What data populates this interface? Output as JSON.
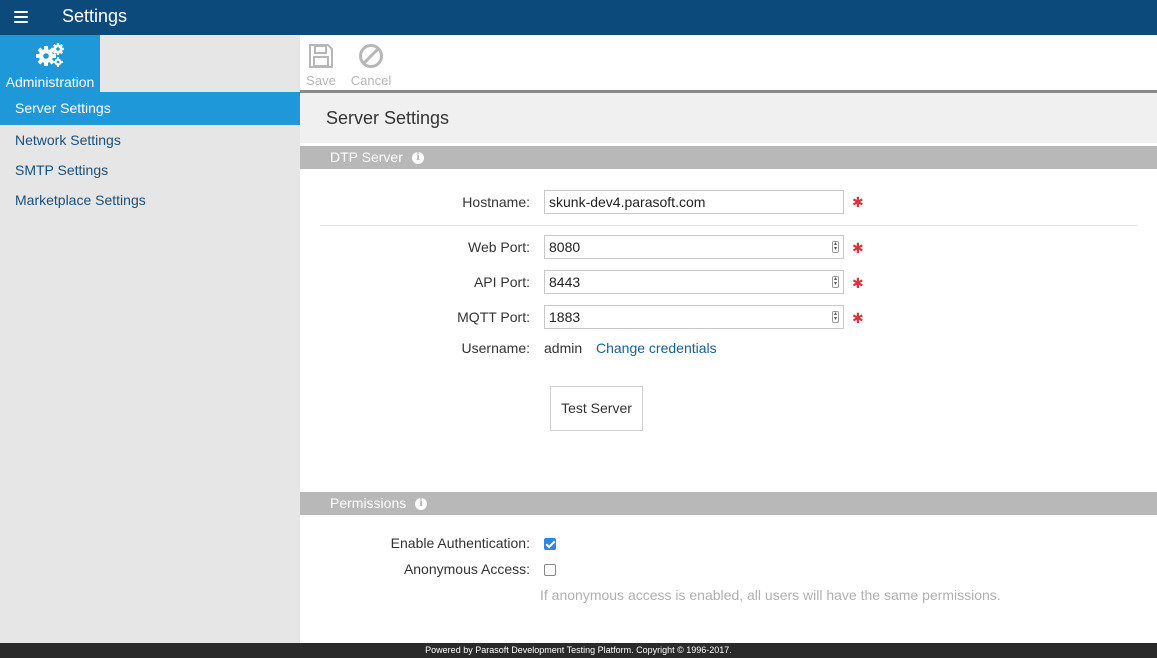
{
  "app": {
    "title": "Settings"
  },
  "sidebar": {
    "admin_label": "Administration",
    "items": [
      {
        "label": "Server Settings",
        "active": true
      },
      {
        "label": "Network Settings",
        "active": false
      },
      {
        "label": "SMTP Settings",
        "active": false
      },
      {
        "label": "Marketplace Settings",
        "active": false
      }
    ]
  },
  "toolbar": {
    "save_label": "Save",
    "cancel_label": "Cancel"
  },
  "page": {
    "title": "Server Settings"
  },
  "dtp_section": {
    "title": "DTP Server",
    "hostname_label": "Hostname:",
    "hostname_value": "skunk-dev4.parasoft.com",
    "web_port_label": "Web Port:",
    "web_port_value": "8080",
    "api_port_label": "API Port:",
    "api_port_value": "8443",
    "mqtt_port_label": "MQTT Port:",
    "mqtt_port_value": "1883",
    "username_label": "Username:",
    "username_value": "admin",
    "change_credentials_label": "Change credentials",
    "test_button_label": "Test Server",
    "required_marker": "✱"
  },
  "permissions_section": {
    "title": "Permissions",
    "enable_auth_label": "Enable Authentication:",
    "enable_auth_checked": true,
    "anonymous_label": "Anonymous Access:",
    "anonymous_checked": false,
    "hint": "If anonymous access is enabled, all users will have the same permissions."
  },
  "footer": {
    "text": "Powered by Parasoft Development Testing Platform. Copyright © 1996-2017."
  },
  "colors": {
    "topbar": "#0d4a7c",
    "accent": "#1e98d8",
    "section_bar": "#b8b8b8",
    "required": "#d9343a",
    "link": "#1a5f8f"
  },
  "icons": {
    "menu": "hamburger-icon",
    "admin": "gears-icon",
    "save": "floppy-disk-icon",
    "cancel": "prohibited-icon",
    "info": "info-icon"
  }
}
